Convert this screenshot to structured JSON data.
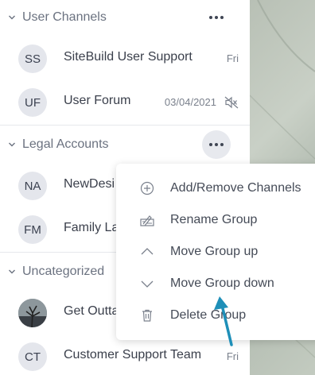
{
  "groups": [
    {
      "title": "User Channels",
      "channels": [
        {
          "initials": "SS",
          "name": "SiteBuild User Support",
          "date": "Fri",
          "muted": false
        },
        {
          "initials": "UF",
          "name": "User Forum",
          "date": "03/04/2021",
          "muted": true
        }
      ]
    },
    {
      "title": "Legal Accounts",
      "channels": [
        {
          "initials": "NA",
          "name": "NewDesi",
          "date": "",
          "muted": false
        },
        {
          "initials": "FM",
          "name": "Family La",
          "date": "",
          "muted": false
        }
      ]
    },
    {
      "title": "Uncategorized",
      "channels": [
        {
          "initials": "",
          "name": "Get Outta",
          "date": "",
          "muted": false,
          "photo": true
        },
        {
          "initials": "CT",
          "name": "Customer Support Team",
          "date": "Fri",
          "muted": false
        }
      ]
    }
  ],
  "context_menu": {
    "items": [
      {
        "label": "Add/Remove Channels",
        "icon": "plus-circle-icon"
      },
      {
        "label": "Rename Group",
        "icon": "rename-icon"
      },
      {
        "label": "Move Group up",
        "icon": "chevron-up-icon"
      },
      {
        "label": "Move Group down",
        "icon": "chevron-down-icon"
      },
      {
        "label": "Delete Group",
        "icon": "trash-icon"
      }
    ]
  },
  "colors": {
    "accent_pointer": "#1e8fb8",
    "avatar_bg": "#e4e6ec",
    "active_button_bg": "#e7e9ee"
  }
}
